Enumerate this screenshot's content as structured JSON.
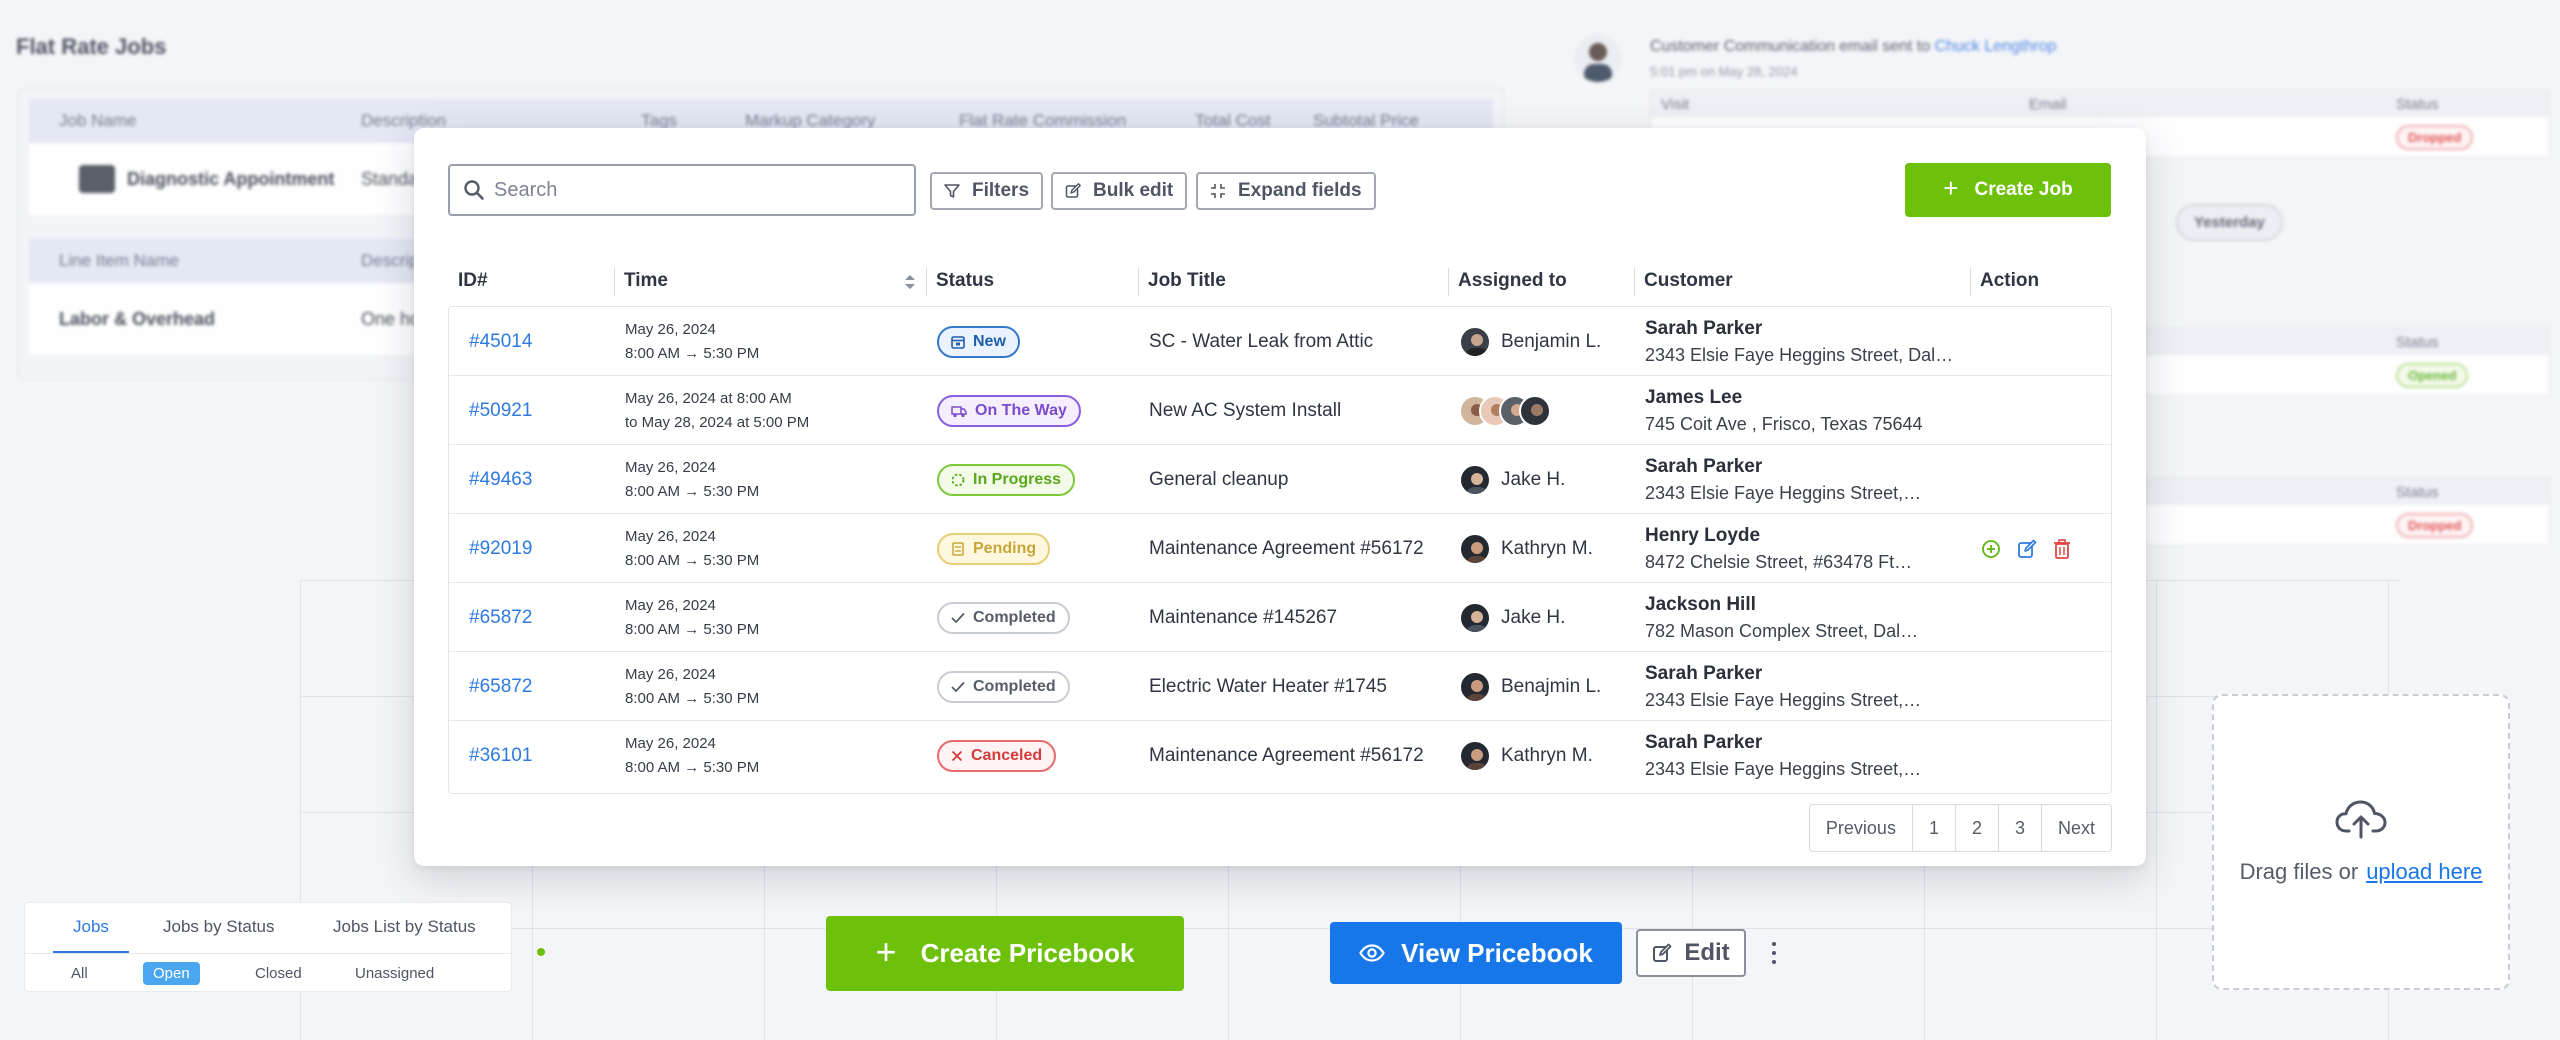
{
  "background": {
    "flat_rate": {
      "title": "Flat Rate Jobs",
      "headers1": [
        "Job Name",
        "Description",
        "Tags",
        "Markup Category",
        "Flat Rate Commission",
        "Total Cost",
        "Subtotal Price"
      ],
      "row1": {
        "name": "Diagnostic Appointment",
        "desc": "Standar"
      },
      "headers2": [
        "Line Item Name",
        "Descript"
      ],
      "row2": {
        "name": "Labor & Overhead",
        "desc": "One hou"
      }
    },
    "feed": {
      "text": "Customer Communication email sent to",
      "link": "Chuck Lengthrop",
      "sub": "5:01 pm on May 28, 2024",
      "cols": [
        "Visit",
        "Email",
        "Status"
      ],
      "status1": "Dropped",
      "yesterday": "Yesterday",
      "status_label2": "Status",
      "status2": "Opened",
      "status_label3": "Status",
      "status3": "Dropped"
    }
  },
  "toolbar": {
    "search_placeholder": "Search",
    "filters": "Filters",
    "bulk_edit": "Bulk edit",
    "expand_fields": "Expand fields",
    "create_job": "Create Job"
  },
  "table": {
    "headers": {
      "id": "ID#",
      "time": "Time",
      "status": "Status",
      "job_title": "Job Title",
      "assigned": "Assigned to",
      "customer": "Customer",
      "action": "Action"
    },
    "rows": [
      {
        "id": "#45014",
        "t1": "May 26, 2024",
        "t2": "8:00 AM → 5:30 PM",
        "status": "New",
        "title": "SC - Water Leak from Attic",
        "assignee": "Benjamin L.",
        "cust": "Sarah Parker",
        "addr": "2343 Elsie Faye Heggins Street, Dal…"
      },
      {
        "id": "#50921",
        "t1": "May 26, 2024 at 8:00 AM",
        "t2": "to May 28, 2024 at 5:00 PM",
        "status": "On The Way",
        "title": "New AC System Install",
        "assignee": "",
        "cust": "James Lee",
        "addr": "745 Coit Ave , Frisco, Texas 75644"
      },
      {
        "id": "#49463",
        "t1": "May 26, 2024",
        "t2": "8:00 AM → 5:30 PM",
        "status": "In Progress",
        "title": "General cleanup",
        "assignee": "Jake H.",
        "cust": "Sarah Parker",
        "addr": "2343 Elsie Faye Heggins Street,…"
      },
      {
        "id": "#92019",
        "t1": "May 26, 2024",
        "t2": "8:00 AM → 5:30 PM",
        "status": "Pending",
        "title": "Maintenance Agreement #56172",
        "assignee": "Kathryn M.",
        "cust": "Henry Loyde",
        "addr": "8472 Chelsie Street, #63478 Ft…"
      },
      {
        "id": "#65872",
        "t1": "May 26, 2024",
        "t2": "8:00 AM → 5:30 PM",
        "status": "Completed",
        "title": "Maintenance #145267",
        "assignee": "Jake H.",
        "cust": "Jackson Hill",
        "addr": "782 Mason Complex  Street, Dal…"
      },
      {
        "id": "#65872",
        "t1": "May 26, 2024",
        "t2": "8:00 AM → 5:30 PM",
        "status": "Completed",
        "title": "Electric Water Heater #1745",
        "assignee": "Benajmin L.",
        "cust": "Sarah Parker",
        "addr": "2343 Elsie Faye Heggins Street,…"
      },
      {
        "id": "#36101",
        "t1": "May 26, 2024",
        "t2": "8:00 AM → 5:30 PM",
        "status": "Canceled",
        "title": "Maintenance Agreement #56172",
        "assignee": "Kathryn M.",
        "cust": "Sarah Parker",
        "addr": "2343 Elsie Faye Heggins Street,…"
      }
    ]
  },
  "pager": {
    "prev": "Previous",
    "p1": "1",
    "p2": "2",
    "p3": "3",
    "next": "Next"
  },
  "tabs": {
    "jobs": "Jobs",
    "by_status": "Jobs by Status",
    "list_by_status": "Jobs List by Status",
    "all": "All",
    "open": "Open",
    "closed": "Closed",
    "unassigned": "Unassigned"
  },
  "buttons": {
    "create_pricebook": "Create Pricebook",
    "view_pricebook": "View Pricebook",
    "edit": "Edit"
  },
  "upload": {
    "text": "Drag files or",
    "link": "upload here"
  },
  "colors": {
    "green": "#6dc10b",
    "blue": "#1777e8",
    "link": "#2d7ae0"
  }
}
